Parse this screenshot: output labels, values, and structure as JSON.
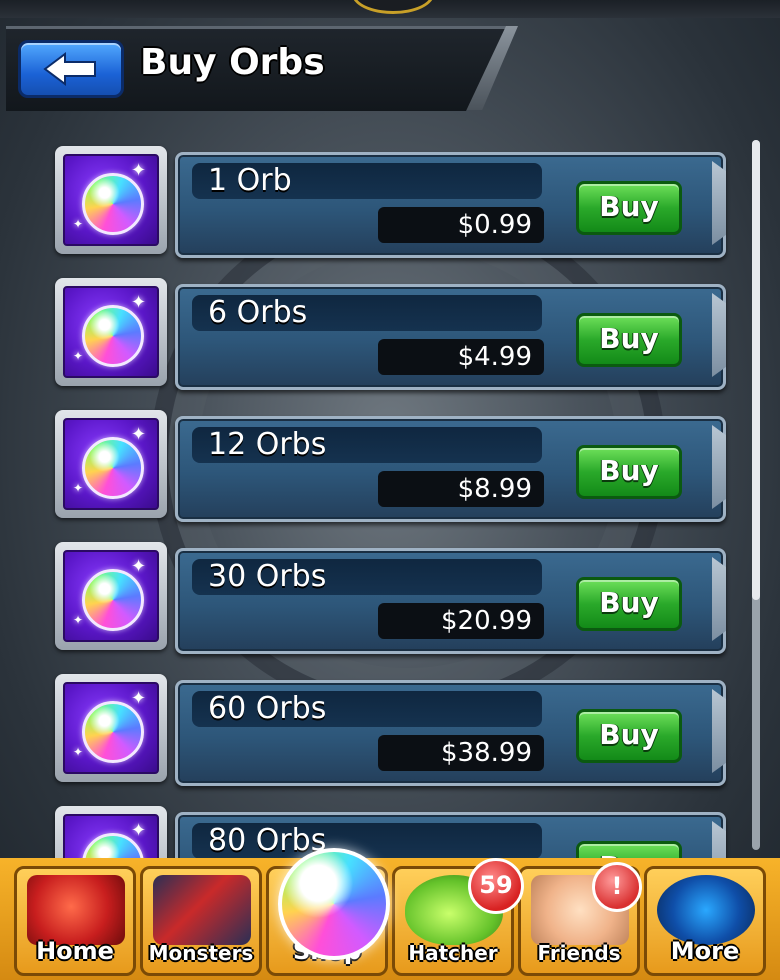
{
  "header": {
    "title": "Buy Orbs",
    "back_label": "back"
  },
  "orb_products": [
    {
      "name": "1 Orb",
      "price": "$0.99",
      "buy_label": "Buy"
    },
    {
      "name": "6 Orbs",
      "price": "$4.99",
      "buy_label": "Buy"
    },
    {
      "name": "12 Orbs",
      "price": "$8.99",
      "buy_label": "Buy"
    },
    {
      "name": "30 Orbs",
      "price": "$20.99",
      "buy_label": "Buy"
    },
    {
      "name": "60 Orbs",
      "price": "$38.99",
      "buy_label": "Buy"
    },
    {
      "name": "80 Orbs",
      "price": "",
      "buy_label": "Buy"
    }
  ],
  "bottom_nav": [
    {
      "label": "Home"
    },
    {
      "label": "Monsters"
    },
    {
      "label": "Shop"
    },
    {
      "label": "Hatcher",
      "badge": "59"
    },
    {
      "label": "Friends",
      "badge": "!"
    },
    {
      "label": "More"
    }
  ],
  "colors": {
    "buy_green": "#2aa92a",
    "back_blue": "#1b62d6",
    "nav_orange": "#f7b32a",
    "card_blue": "#2d5679"
  }
}
